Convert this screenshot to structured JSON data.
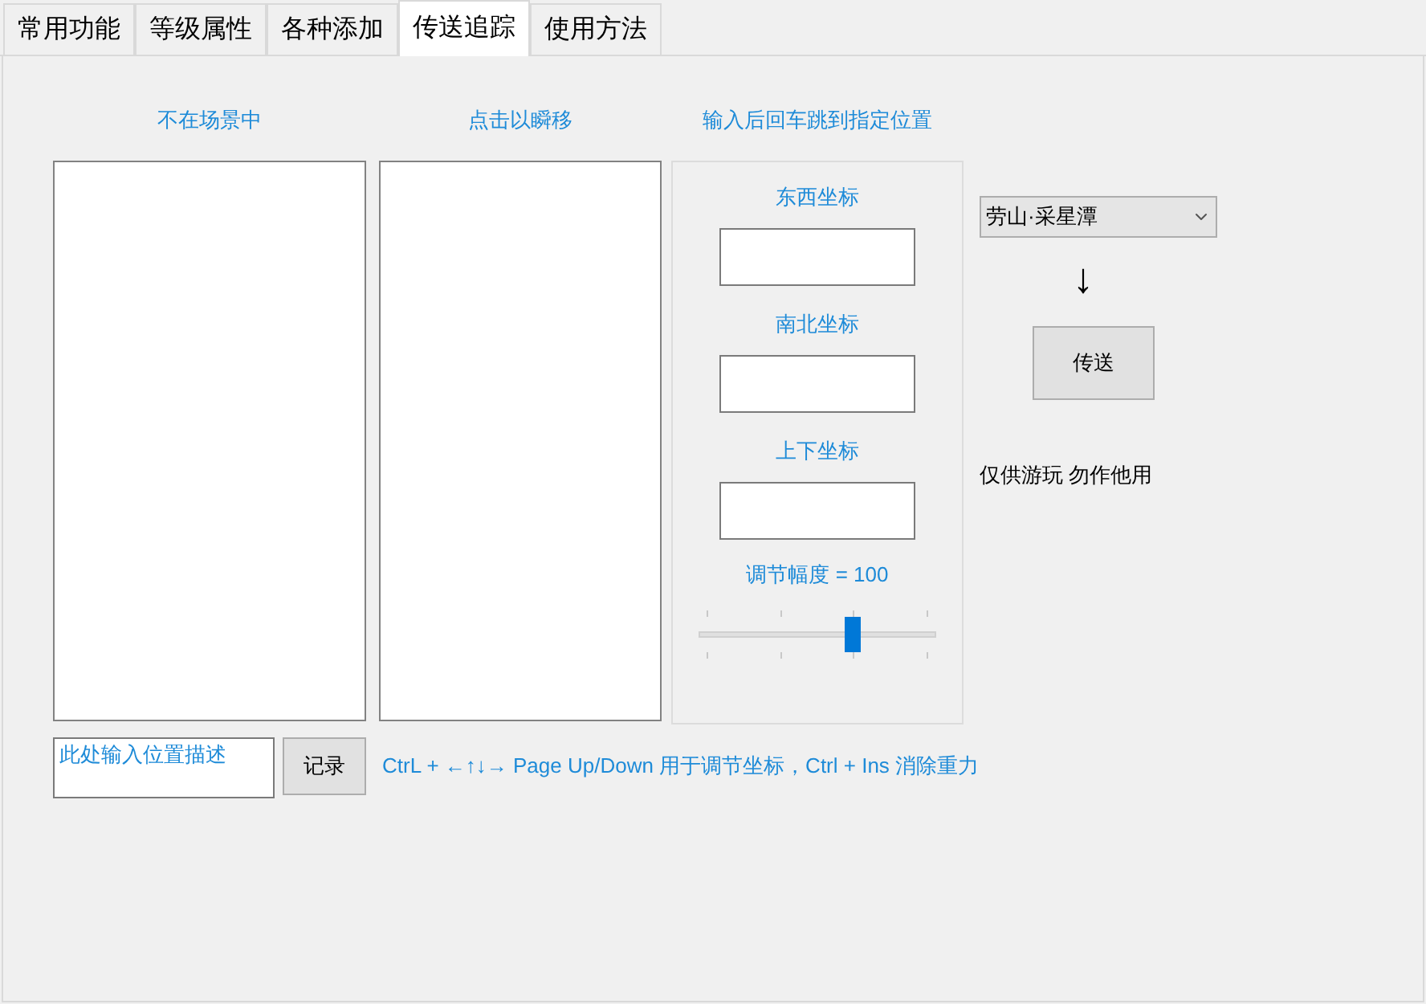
{
  "tabs": [
    {
      "label": "常用功能",
      "selected": false
    },
    {
      "label": "等级属性",
      "selected": false
    },
    {
      "label": "各种添加",
      "selected": false
    },
    {
      "label": "传送追踪",
      "selected": true
    },
    {
      "label": "使用方法",
      "selected": false
    }
  ],
  "lists": [
    {
      "caption": "不在场景中"
    },
    {
      "caption": "点击以瞬移"
    }
  ],
  "coords": {
    "caption": "输入后回车跳到指定位置",
    "fields": [
      {
        "label": "东西坐标"
      },
      {
        "label": "南北坐标"
      },
      {
        "label": "上下坐标"
      }
    ],
    "step_label": "调节幅度 = 100",
    "step_slider": {
      "level": 0.667
    }
  },
  "location_select": {
    "value": "劳山·采星潭"
  },
  "arrow": "↓",
  "teleport_button": "传送",
  "notice": "仅供游玩 勿作他用",
  "description_field": {
    "value": "此处输入位置描述"
  },
  "record_button": "记录",
  "hint": "CtrL + ←↑↓→ Page Up/Down 用于调节坐标，Ctrl + Ins 消除重力"
}
